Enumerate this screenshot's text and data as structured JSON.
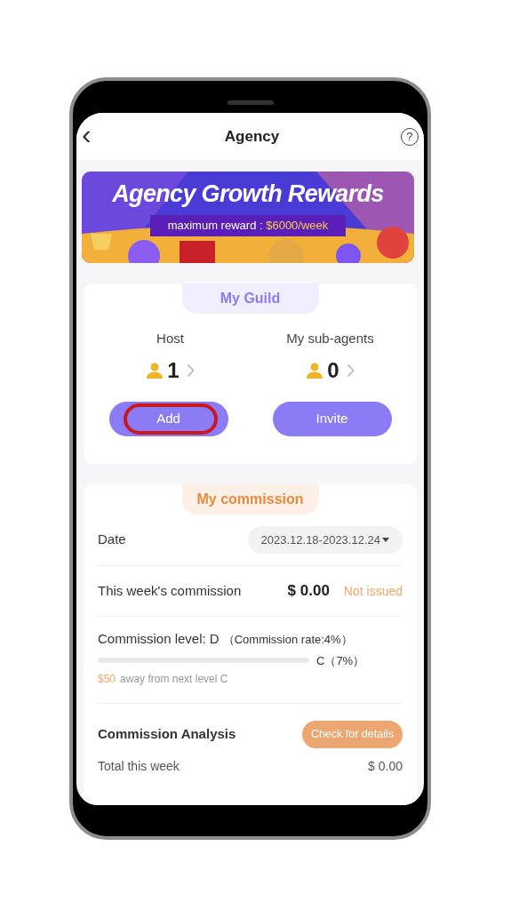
{
  "header": {
    "back": "‹",
    "title": "Agency",
    "help": "?"
  },
  "banner": {
    "title": "Agency Growth Rewards",
    "subtitle_prefix": "maximum reward : ",
    "subtitle_amount": "$6000/week"
  },
  "guild": {
    "title": "My Guild",
    "stats": [
      {
        "label": "Host",
        "count": "1"
      },
      {
        "label": "My sub-agents",
        "count": "0"
      }
    ],
    "buttons": [
      {
        "label": "Add",
        "highlighted": true
      },
      {
        "label": "Invite",
        "highlighted": false
      }
    ]
  },
  "commission": {
    "title": "My commission",
    "date_label": "Date",
    "date_value": "2023.12.18-2023.12.24",
    "week_label": "This week's commission",
    "week_amount": "$ 0.00",
    "week_status": "Not issued",
    "level_label": "Commission level: D",
    "level_rate": "（Commission rate:4%）",
    "progress": {
      "level": 0
    },
    "next_level": "C（7%）",
    "away_amount": "$50",
    "away_text": "away from next level C",
    "analysis_title": "Commission Analysis",
    "details_button": "Check for details",
    "total_label": "Total this week",
    "total_value": "$ 0.00"
  }
}
